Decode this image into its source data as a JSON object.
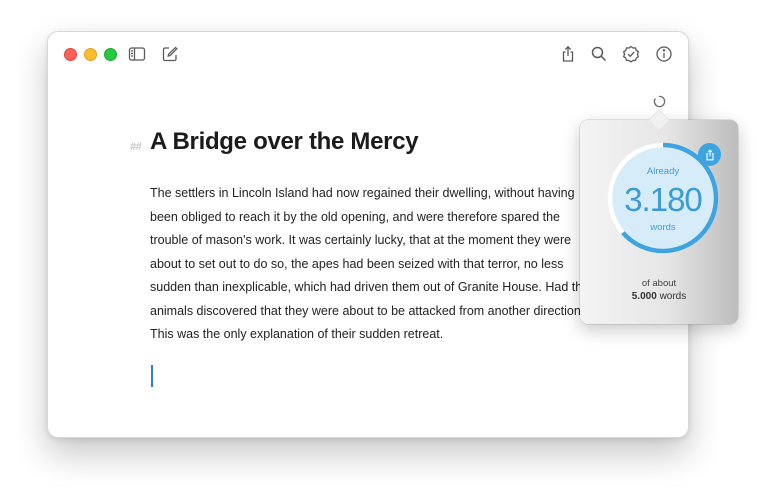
{
  "window": {
    "toolbar": {
      "icons": [
        "sidebar-icon",
        "compose-icon",
        "share-icon",
        "search-icon",
        "checkmark-badge-icon",
        "info-icon"
      ]
    }
  },
  "document": {
    "heading_marker": "##",
    "title": "A Bridge over the Mercy",
    "lines": [
      "The settlers in Lincoln Island had now regained their dwelling, without having",
      "been obliged to reach it by the old opening, and were therefore spared the",
      "trouble of mason's work. It was certainly lucky, that at the moment they were",
      "about to set out to do so, the apes had been seized with that terror, no less",
      "sudden than inexplicable, which had driven them out of Granite House. Had the",
      "animals discovered that they were about to be attacked from another direction?",
      "This was the only explanation of their sudden retreat."
    ]
  },
  "word_goal": {
    "label_top": "Already",
    "count": "3.180",
    "label_bottom": "words",
    "goal_prefix": "of about",
    "goal_value": "5.000",
    "goal_unit": "words",
    "progress": 0.636,
    "accent_color": "#3ea4e0"
  }
}
